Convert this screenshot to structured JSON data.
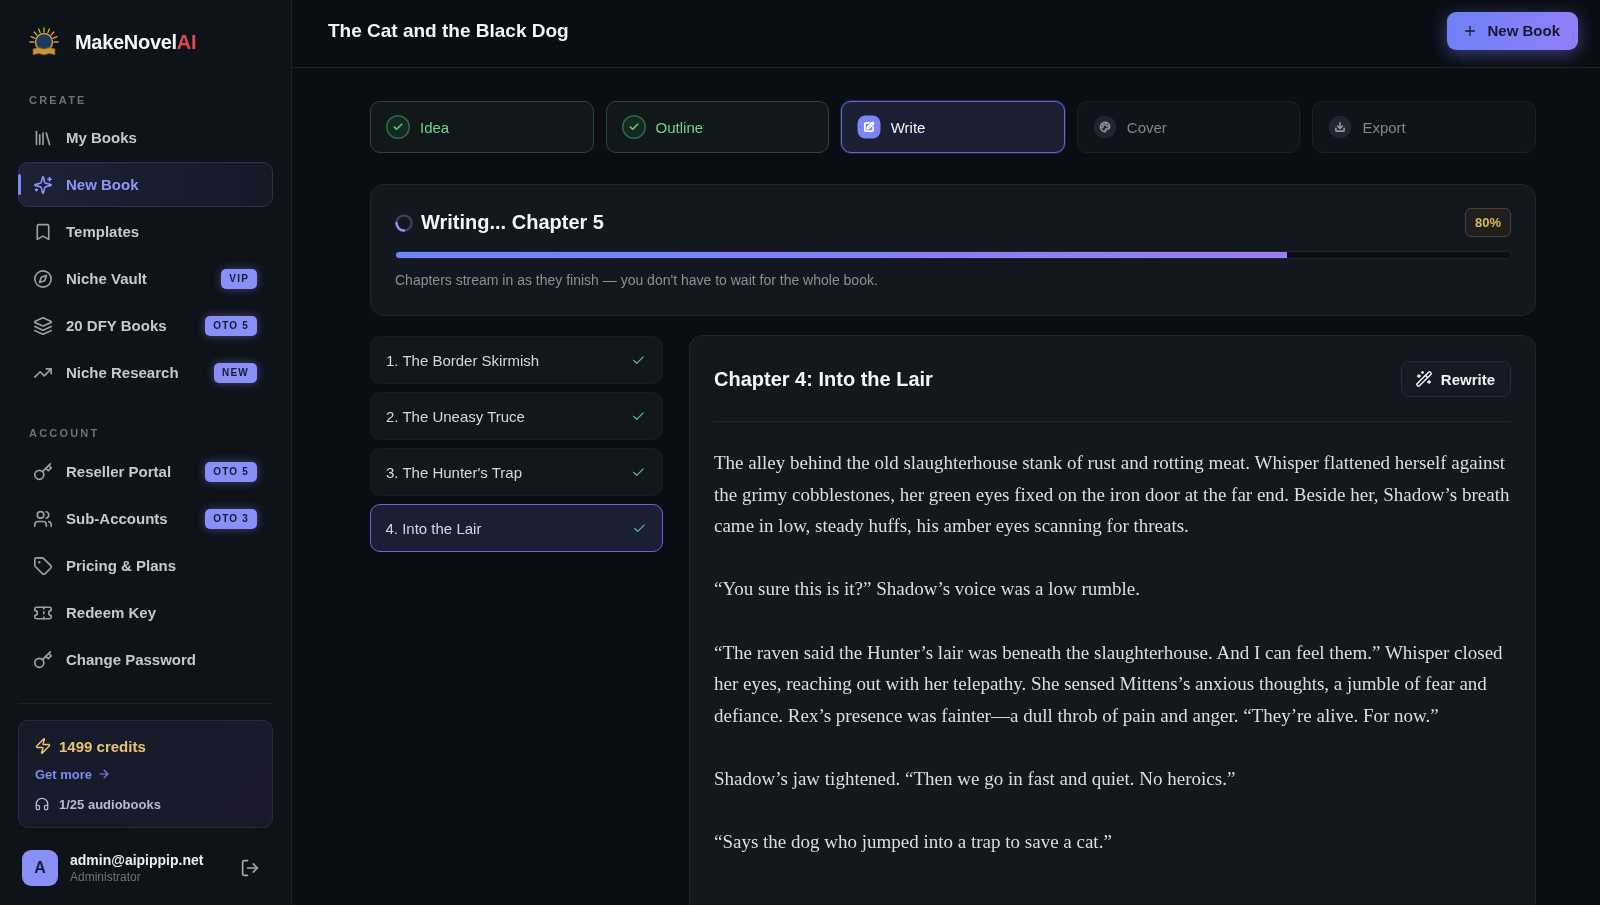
{
  "sidebar": {
    "brand": {
      "name": "MakeNovel",
      "accent": "AI"
    },
    "sections": [
      {
        "title": "CREATE",
        "items": [
          {
            "label": "My Books",
            "selected": false
          },
          {
            "label": "New Book",
            "selected": true
          },
          {
            "label": "Templates",
            "selected": false
          },
          {
            "label": "Niche Vault",
            "selected": false,
            "badge": "VIP"
          },
          {
            "label": "20 DFY Books",
            "selected": false,
            "badge": "OTO 5"
          },
          {
            "label": "Niche Research",
            "selected": false,
            "badge": "NEW"
          }
        ]
      },
      {
        "title": "ACCOUNT",
        "items": [
          {
            "label": "Reseller Portal",
            "selected": false,
            "badge": "OTO 5"
          },
          {
            "label": "Sub-Accounts",
            "selected": false,
            "badge": "OTO 3"
          },
          {
            "label": "Pricing & Plans",
            "selected": false
          },
          {
            "label": "Redeem Key",
            "selected": false
          },
          {
            "label": "Change Password",
            "selected": false
          }
        ]
      }
    ],
    "credits": {
      "amount": "1499 credits",
      "link": "Get more",
      "audiobooks": "1/25 audiobooks"
    },
    "user": {
      "avatar": "A",
      "email": "admin@aipippip.net",
      "role": "Administrator"
    }
  },
  "header": {
    "title": "The Cat and the Black Dog",
    "button": "New Book"
  },
  "steps": [
    {
      "label": "Idea",
      "done": true,
      "selected": false
    },
    {
      "label": "Outline",
      "done": true,
      "selected": false
    },
    {
      "label": "Write",
      "done": false,
      "selected": true
    },
    {
      "label": "Cover",
      "done": false,
      "selected": false
    },
    {
      "label": "Export",
      "done": false,
      "selected": false
    }
  ],
  "progress": {
    "title": "Writing... Chapter 5",
    "percent": "80%",
    "level": 0.8,
    "caption": "Chapters stream in as they finish — you don't have to wait for the whole book."
  },
  "chapters": [
    {
      "label": "1. The Border Skirmish",
      "done": true,
      "selected": false
    },
    {
      "label": "2. The Uneasy Truce",
      "done": true,
      "selected": false
    },
    {
      "label": "3. The Hunter's Trap",
      "done": true,
      "selected": false
    },
    {
      "label": "4. Into the Lair",
      "done": true,
      "selected": true
    }
  ],
  "chapter_view": {
    "title": "Chapter 4: Into the Lair",
    "button": "Rewrite",
    "paragraphs": [
      "The alley behind the old slaughterhouse stank of rust and rotting meat. Whisper flattened herself against the grimy cobblestones, her green eyes fixed on the iron door at the far end. Beside her, Shadow’s breath came in low, steady huffs, his amber eyes scanning for threats.",
      "“You sure this is it?” Shadow’s voice was a low rumble.",
      "“The raven said the Hunter’s lair was beneath the slaughterhouse. And I can feel them.” Whisper closed her eyes, reaching out with her telepathy. She sensed Mittens’s anxious thoughts, a jumble of fear and defiance. Rex’s presence was fainter—a dull throb of pain and anger. “They’re alive. For now.”",
      "Shadow’s jaw tightened. “Then we go in fast and quiet. No heroics.”",
      "“Says the dog who jumped into a trap to save a cat.”"
    ]
  }
}
